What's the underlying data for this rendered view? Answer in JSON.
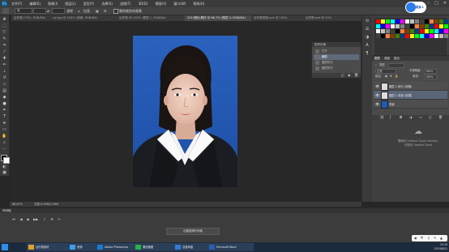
{
  "menu": {
    "app_icon": "Ps",
    "items": [
      "文件(F)",
      "编辑(E)",
      "图像(I)",
      "图层(L)",
      "类型(Y)",
      "选择(S)",
      "滤镜(T)",
      "3D(D)",
      "视图(V)",
      "窗口(W)",
      "帮助(H)"
    ]
  },
  "options": {
    "field1": "宽",
    "label1": "比例",
    "label2": "清除",
    "label3": "拉直",
    "checkbox_label": "删除裁剪的像素"
  },
  "tabs": [
    {
      "label": "证件照 (75%, RGB/8#)"
    },
    {
      "label": "zjz.jpg @ 100% (背景, RGB/8#)"
    },
    {
      "label": "证件照 @ 100% (图层 1, RGB/8#)"
    },
    {
      "label": "2019图片素材 @ 66.7% (图层 0, RGB/8#)",
      "active": true
    },
    {
      "label": "证件照修图.psd @ 100%"
    },
    {
      "label": "证件照.psd @ 50%"
    }
  ],
  "history": {
    "title": "历史记录",
    "rows": [
      {
        "label": "打开"
      },
      {
        "label": "裁剪",
        "selected": true
      },
      {
        "label": "图层样式"
      },
      {
        "label": "图层样式"
      }
    ]
  },
  "layers": {
    "tabs": [
      "图层",
      "通道",
      "路径"
    ],
    "kind_label": "类型",
    "blend_mode": "正常",
    "opacity_label": "不透明度:",
    "opacity_value": "100%",
    "lock_label": "锁定:",
    "fill_label": "填充:",
    "fill_value": "100%",
    "items": [
      {
        "name": "图层 1 拷贝 (效果)"
      },
      {
        "name": "图层 1 背景 (效果)",
        "selected": true
      },
      {
        "name": "背景"
      }
    ]
  },
  "cc_libraries": {
    "line1": "要使用 Creative Cloud Libraries,",
    "line2": "请登录 Creative Cloud"
  },
  "status": {
    "zoom": "66.67%",
    "doc": "文档:3.39M/3.39M"
  },
  "timeline": {
    "title": "时间轴",
    "make_button": "创建视频时间轴"
  },
  "taskbar": {
    "tasks": [
      {
        "label": "证件照素材",
        "color": "#e0a12a"
      },
      {
        "label": "资源",
        "color": "#3aa0e6"
      },
      {
        "label": "Adobe Photoshop",
        "color": "#1a7bd0"
      },
      {
        "label": "微信截图",
        "color": "#26b24b"
      },
      {
        "label": "百度网盘",
        "color": "#2e7dd8"
      },
      {
        "label": "Microsoft Word",
        "color": "#2b5eb5"
      }
    ],
    "time": "10:16",
    "date": "2019/8/21"
  },
  "badge": {
    "text": "联系人"
  },
  "colors": {
    "photo_bg": "#1f5bb6",
    "selection": "#5a6578"
  }
}
